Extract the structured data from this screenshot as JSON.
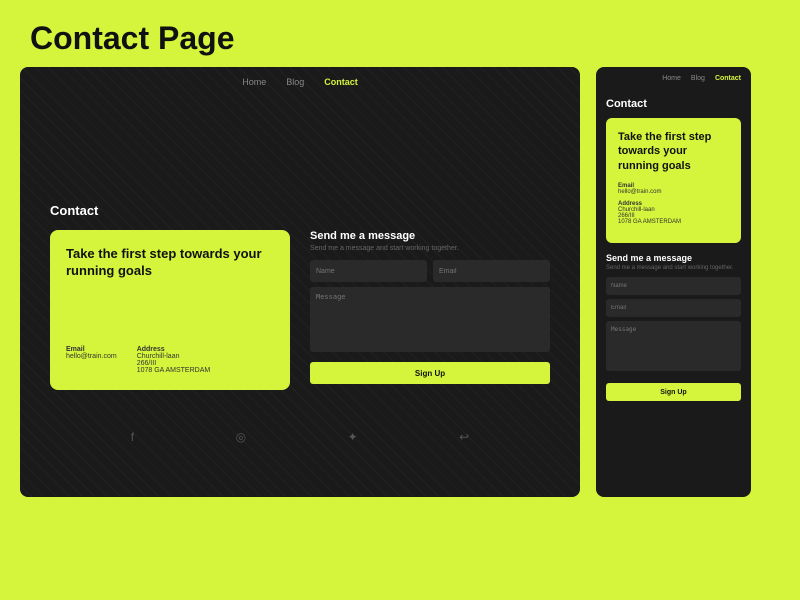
{
  "page": {
    "title": "Contact Page",
    "bg_color": "#d4f53c"
  },
  "desktop": {
    "nav": {
      "items": [
        {
          "label": "Home",
          "active": false
        },
        {
          "label": "Blog",
          "active": false
        },
        {
          "label": "Contact",
          "active": true
        }
      ]
    },
    "contact_label": "Contact",
    "card": {
      "title": "Take the first step towards your running goals",
      "email_label": "Email",
      "email_value": "hello@train.com",
      "address_label": "Address",
      "address_value": "Churchill-laan\n266/III\n1078 GA AMSTERDAM"
    },
    "form": {
      "title": "Send me a message",
      "subtitle": "Send me a message and start working together.",
      "name_placeholder": "Name",
      "email_placeholder": "Email",
      "message_placeholder": "Message",
      "submit_label": "Sign Up"
    },
    "footer_icons": [
      "f",
      "ο",
      "♦",
      "↩"
    ]
  },
  "mobile": {
    "nav": {
      "items": [
        {
          "label": "Home",
          "active": false
        },
        {
          "label": "Blog",
          "active": false
        },
        {
          "label": "Contact",
          "active": true
        }
      ]
    },
    "contact_label": "Contact",
    "card": {
      "title": "Take the first step towards your running goals",
      "email_label": "Email",
      "email_value": "hello@train.com",
      "address_label": "Address",
      "address_line1": "Churchill-laan",
      "address_line2": "266/III",
      "address_line3": "1078 GA AMSTERDAM"
    },
    "form": {
      "title": "Send me a message",
      "subtitle": "Send me a message and start working together.",
      "name_placeholder": "Name",
      "email_placeholder": "Email",
      "message_placeholder": "Message",
      "submit_label": "Sign Up"
    }
  }
}
